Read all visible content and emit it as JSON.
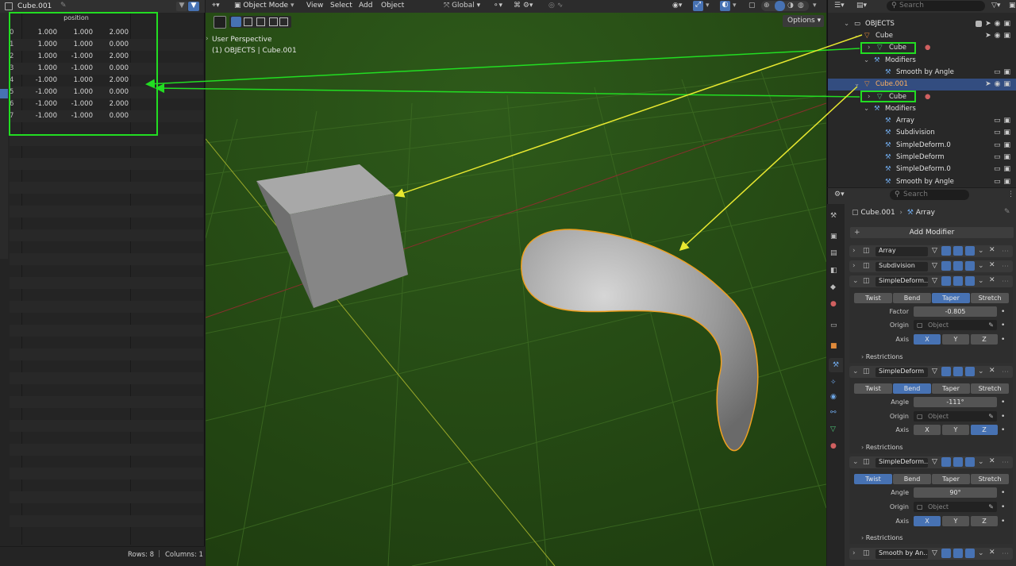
{
  "spreadsheet": {
    "object_name": "Cube.001",
    "column_header": "position",
    "rows": [
      {
        "idx": "0",
        "x": "1.000",
        "y": "1.000",
        "z": "2.000"
      },
      {
        "idx": "1",
        "x": "1.000",
        "y": "1.000",
        "z": "0.000"
      },
      {
        "idx": "2",
        "x": "1.000",
        "y": "-1.000",
        "z": "2.000"
      },
      {
        "idx": "3",
        "x": "1.000",
        "y": "-1.000",
        "z": "0.000"
      },
      {
        "idx": "4",
        "x": "-1.000",
        "y": "1.000",
        "z": "2.000"
      },
      {
        "idx": "5",
        "x": "-1.000",
        "y": "1.000",
        "z": "0.000"
      },
      {
        "idx": "6",
        "x": "-1.000",
        "y": "-1.000",
        "z": "2.000"
      },
      {
        "idx": "7",
        "x": "-1.000",
        "y": "-1.000",
        "z": "0.000"
      }
    ],
    "footer_rows": "Rows: 8",
    "footer_cols": "Columns: 1"
  },
  "viewport": {
    "mode": "Object Mode",
    "menu": [
      "View",
      "Select",
      "Add",
      "Object"
    ],
    "orientation": "Global",
    "options": "Options",
    "info_line1": "User Perspective",
    "info_line2": "(1) OBJECTS | Cube.001",
    "grid_color": "#3c6a22",
    "selected_outline": "#f0a020"
  },
  "outliner": {
    "search_placeholder": "Search",
    "collection": "OBJECTS",
    "items": [
      {
        "label": "Cube",
        "level": 1
      },
      {
        "label": "Cube",
        "level": 2
      },
      {
        "label": "Modifiers",
        "level": 2
      },
      {
        "label": "Smooth by Angle",
        "level": 3
      },
      {
        "label": "Cube.001",
        "level": 1
      },
      {
        "label": "Cube",
        "level": 2
      },
      {
        "label": "Modifiers",
        "level": 2
      },
      {
        "label": "Array",
        "level": 3
      },
      {
        "label": "Subdivision",
        "level": 3
      },
      {
        "label": "SimpleDeform.0",
        "level": 3
      },
      {
        "label": "SimpleDeform",
        "level": 3
      },
      {
        "label": "SimpleDeform.0",
        "level": 3
      },
      {
        "label": "Smooth by Angle",
        "level": 3
      }
    ]
  },
  "properties": {
    "search_placeholder": "Search",
    "breadcrumb_object": "Cube.001",
    "breadcrumb_modifier": "Array",
    "add_modifier": "Add Modifier",
    "modifiers": [
      {
        "name": "Array"
      },
      {
        "name": "Subdivision"
      },
      {
        "name": "SimpleDeform..."
      },
      {
        "name": "SimpleDeform"
      },
      {
        "name": "SimpleDeform..."
      },
      {
        "name": "Smooth by An..."
      }
    ],
    "deform_modes": [
      "Twist",
      "Bend",
      "Taper",
      "Stretch"
    ],
    "deform1": {
      "factor_label": "Factor",
      "factor": "-0.805",
      "origin_label": "Origin",
      "origin_placeholder": "Object",
      "axis_label": "Axis"
    },
    "deform2": {
      "angle_label": "Angle",
      "angle": "-111°",
      "origin_label": "Origin",
      "origin_placeholder": "Object",
      "axis_label": "Axis"
    },
    "deform3": {
      "angle_label": "Angle",
      "angle": "90°",
      "origin_label": "Origin",
      "origin_placeholder": "Object",
      "axis_label": "Axis"
    },
    "axes": [
      "X",
      "Y",
      "Z"
    ],
    "restrictions": "Restrictions"
  },
  "colors": {
    "accent": "#4772b3",
    "annotation_green": "#22dd22",
    "annotation_yellow": "#e8e830"
  }
}
